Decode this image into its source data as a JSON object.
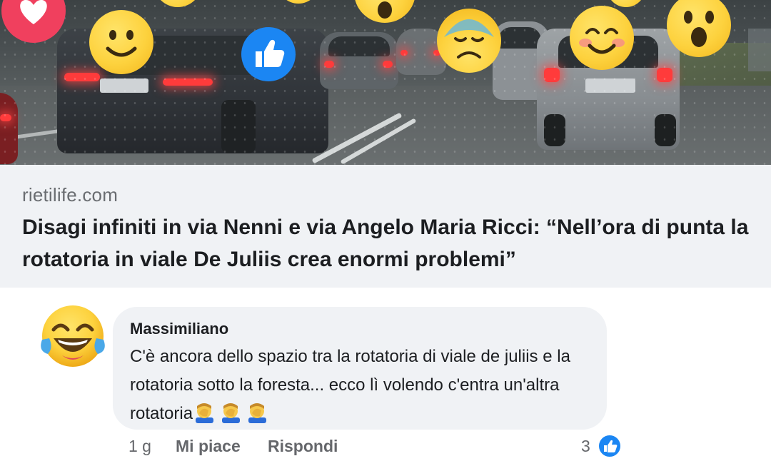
{
  "link_preview": {
    "domain": "rietilife.com",
    "title": "Disagi infiniti in via Nenni e via Angelo Maria Ricci: “Nell’ora di punta la rotatoria in viale De Juliis crea enormi problemi”",
    "image_overlay_reactions": [
      "heart-icon",
      "smile-emoji",
      "like-icon",
      "sad-sweat-emoji",
      "blush-smile-emoji",
      "wow-emoji"
    ]
  },
  "comment": {
    "avatar_emoji": "laughing-tears-emoji",
    "author": "Massimiliano",
    "text": "C'è ancora dello spazio tra la rotatoria di viale de juliis e la rotatoria sotto la foresta... ecco lì volendo c'entra un'altra rotatoria",
    "trailing_emojis": [
      "facepalm-emoji",
      "facepalm-emoji",
      "facepalm-emoji"
    ],
    "time": "1 g",
    "like_label": "Mi piace",
    "reply_label": "Rispondi",
    "reaction_count": "3",
    "reaction_icon": "like-icon"
  },
  "colors": {
    "accent_blue": "#1b86f3",
    "heart_red": "#f0405e",
    "bubble_bg": "#f0f2f5",
    "meta_text": "#65676b"
  }
}
